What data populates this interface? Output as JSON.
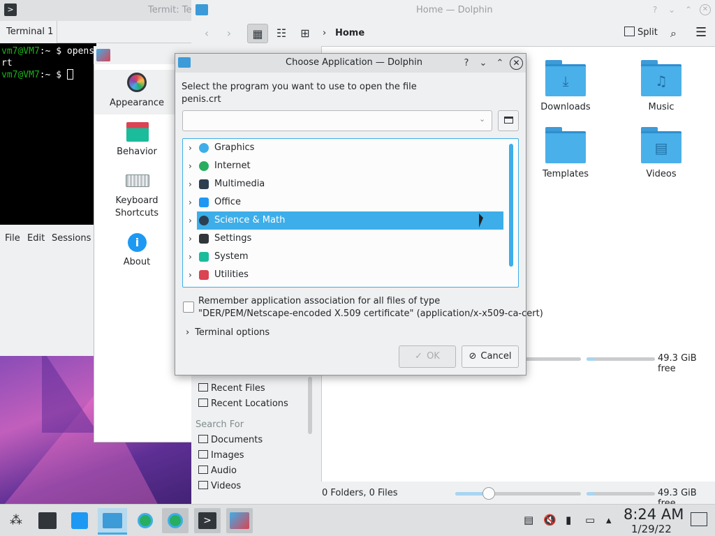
{
  "terminal": {
    "title": "Termit: Te",
    "tab": "Terminal 1",
    "line1_prompt": "vm7@VM7",
    "line1_cmd": ":~ $ openss",
    "line2": "rt",
    "line3_prompt": "vm7@VM7",
    "line3_cmd": ":~ $ ",
    "menu": [
      "File",
      "Edit",
      "Sessions"
    ]
  },
  "settings": {
    "items": [
      {
        "label": "Appearance",
        "icon": "appearance-icon"
      },
      {
        "label": "Behavior",
        "icon": "behavior-icon"
      },
      {
        "label": "Keyboard\nShortcuts",
        "icon": "keyboard-icon"
      },
      {
        "label": "About",
        "icon": "info-icon"
      }
    ]
  },
  "dolphin": {
    "title": "Home — Dolphin",
    "breadcrumb": "Home",
    "split_label": "Split",
    "folders": [
      {
        "label": "Downloads",
        "icon": "download-icon"
      },
      {
        "label": "Music",
        "icon": "music-icon"
      },
      {
        "label": "Templates",
        "icon": "template-icon"
      },
      {
        "label": "Videos",
        "icon": "video-icon"
      }
    ],
    "sidebar": {
      "recent": [
        "Recent Files",
        "Recent Locations"
      ],
      "search_heading": "Search For",
      "search": [
        "Documents",
        "Images",
        "Audio",
        "Videos"
      ]
    },
    "free_space_top": "49.3 GiB free",
    "status": "0 Folders, 0 Files",
    "free_space": "49.3 GiB free"
  },
  "dialog": {
    "title": "Choose Application — Dolphin",
    "prompt_line1": "Select the program you want to use to open the file",
    "prompt_line2": "penis.crt",
    "categories": [
      {
        "label": "Graphics",
        "color": "#3daee9"
      },
      {
        "label": "Internet",
        "color": "#27ae60"
      },
      {
        "label": "Multimedia",
        "color": "#2c3e50"
      },
      {
        "label": "Office",
        "color": "#1d99f3"
      },
      {
        "label": "Science & Math",
        "color": "#2c3e50"
      },
      {
        "label": "Settings",
        "color": "#31363b"
      },
      {
        "label": "System",
        "color": "#1abc9c"
      },
      {
        "label": "Utilities",
        "color": "#da4453"
      }
    ],
    "selected_category": "Science & Math",
    "remember_line1": "Remember application association for all files of type",
    "remember_line2": "\"DER/PEM/Netscape-encoded X.509 certificate\" (application/x-x509-ca-cert)",
    "terminal_options": "Terminal options",
    "ok_label": "OK",
    "cancel_label": "Cancel"
  },
  "taskbar": {
    "time": "8:24 AM",
    "date": "1/29/22"
  },
  "colors": {
    "accent": "#3daee9",
    "selection_text": "#ffffff"
  }
}
